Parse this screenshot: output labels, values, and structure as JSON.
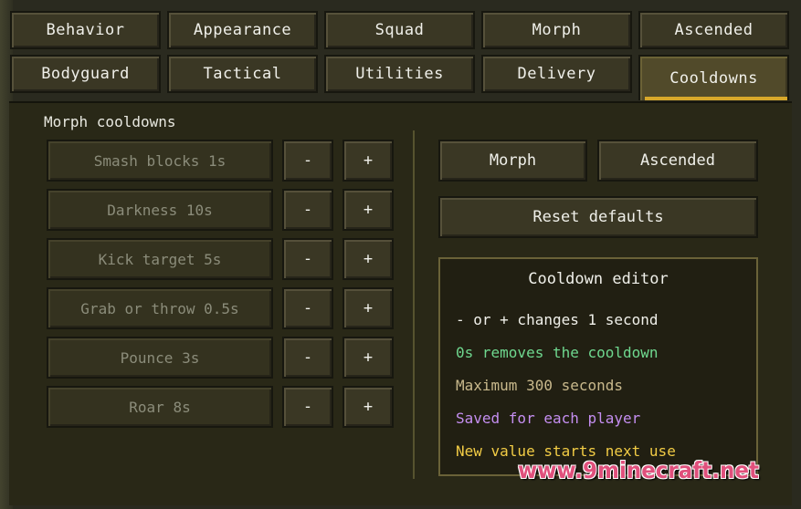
{
  "tabs_row1": [
    {
      "label": "Behavior",
      "active": false
    },
    {
      "label": "Appearance",
      "active": false
    },
    {
      "label": "Squad",
      "active": false
    },
    {
      "label": "Morph",
      "active": false
    },
    {
      "label": "Ascended",
      "active": false
    }
  ],
  "tabs_row2": [
    {
      "label": "Bodyguard",
      "active": false
    },
    {
      "label": "Tactical",
      "active": false
    },
    {
      "label": "Utilities",
      "active": false
    },
    {
      "label": "Delivery",
      "active": false
    },
    {
      "label": "Cooldowns",
      "active": true
    }
  ],
  "section_title": "Morph cooldowns",
  "cooldowns": [
    {
      "label": "Smash blocks  1s",
      "minus": "-",
      "plus": "+"
    },
    {
      "label": "Darkness  10s",
      "minus": "-",
      "plus": "+"
    },
    {
      "label": "Kick target  5s",
      "minus": "-",
      "plus": "+"
    },
    {
      "label": "Grab or throw  0.5s",
      "minus": "-",
      "plus": "+"
    },
    {
      "label": "Pounce  3s",
      "minus": "-",
      "plus": "+"
    },
    {
      "label": "Roar  8s",
      "minus": "-",
      "plus": "+"
    }
  ],
  "mode_buttons": {
    "morph": "Morph",
    "ascended": "Ascended"
  },
  "reset_label": "Reset defaults",
  "editor": {
    "title": "Cooldown editor",
    "lines": [
      {
        "text": "- or + changes 1 second",
        "color": "#f0f0ea"
      },
      {
        "text": "0s removes the cooldown",
        "color": "#6fd88f"
      },
      {
        "text": "Maximum 300 seconds",
        "color": "#c9b98c"
      },
      {
        "text": "Saved for each player",
        "color": "#c48ef0"
      },
      {
        "text": "New value starts next use",
        "color": "#f2cc45"
      }
    ]
  },
  "colors": {
    "accent": "#d7a82a",
    "panel": "#292817"
  },
  "watermark": "www.9minecraft.net"
}
